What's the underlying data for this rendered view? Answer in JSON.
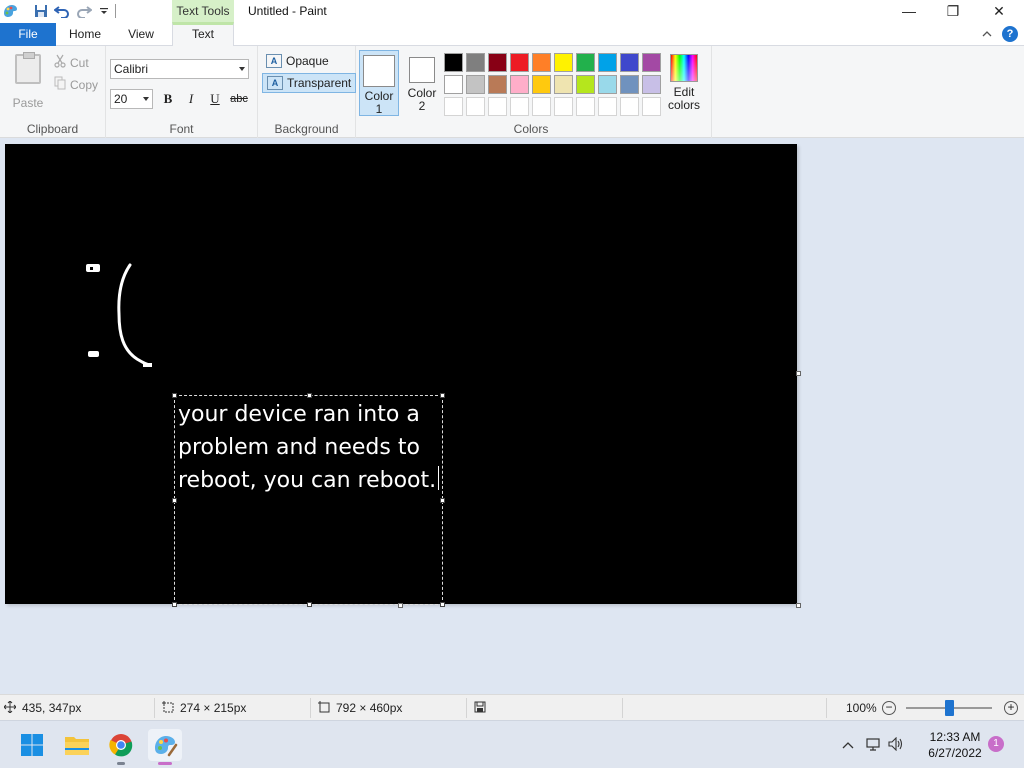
{
  "window": {
    "title": "Untitled - Paint",
    "context_tab": "Text Tools",
    "minimize": "—",
    "maximize": "❐",
    "close": "✕"
  },
  "tabs": [
    {
      "label": "File"
    },
    {
      "label": "Home"
    },
    {
      "label": "View"
    },
    {
      "label": "Text",
      "active": true
    }
  ],
  "clipboard": {
    "paste": "Paste",
    "cut": "Cut",
    "copy": "Copy",
    "group_label": "Clipboard"
  },
  "font": {
    "family": "Calibri",
    "size": "20",
    "bold": "B",
    "italic": "I",
    "underline": "U",
    "strikethrough": "abc",
    "group_label": "Font"
  },
  "background": {
    "opaque": "Opaque",
    "transparent": "Transparent",
    "selected": "Transparent",
    "group_label": "Background"
  },
  "colors": {
    "color1_line1": "Color",
    "color1_line2": "1",
    "color2_line1": "Color",
    "color2_line2": "2",
    "edit_line1": "Edit",
    "edit_line2": "colors",
    "group_label": "Colors",
    "palette": [
      "#000000",
      "#7f7f7f",
      "#880015",
      "#ed1c24",
      "#ff7f27",
      "#fff200",
      "#22b14c",
      "#00a2e8",
      "#3f48cc",
      "#a349a4",
      "#ffffff",
      "#c3c3c3",
      "#b97a57",
      "#ffaec9",
      "#ffc90e",
      "#efe4b0",
      "#b5e61d",
      "#99d9ea",
      "#7092be",
      "#c8bfe7"
    ],
    "empty_slots": 10
  },
  "canvas": {
    "text_lines": [
      "your device ran into a",
      "problem and needs to",
      "reboot, you can reboot."
    ]
  },
  "status": {
    "cursor_position": "435, 347px",
    "selection_size": "274 × 215px",
    "canvas_size": "792 × 460px",
    "zoom": "100%",
    "zoom_level": 0.5
  },
  "taskbar": {
    "time": "12:33 AM",
    "date": "6/27/2022",
    "notifications": "1",
    "apps": [
      "start-icon",
      "file-explorer-icon",
      "chrome-icon",
      "paint-icon"
    ]
  }
}
